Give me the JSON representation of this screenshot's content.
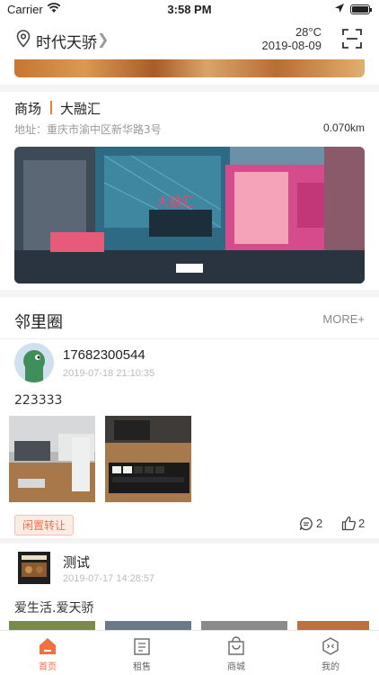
{
  "status_bar": {
    "carrier": "Carrier",
    "time": "3:58 PM"
  },
  "header": {
    "location": "时代天骄",
    "temperature": "28°C",
    "date": "2019-08-09"
  },
  "mall": {
    "type_label": "商场",
    "name": "大融汇",
    "address": "地址：重庆市渝中区新华路3号",
    "distance": "0.070km"
  },
  "neighbor": {
    "title": "邻里圈",
    "more": "MORE+",
    "posts": [
      {
        "user": "17682300544",
        "time": "2019-07-18 21:10:35",
        "text": "223333",
        "tag": "闲置转让",
        "comments": "2",
        "likes": "2"
      },
      {
        "user": "测试",
        "time": "2019-07-17 14:28:57",
        "text": "爱生活.爱天骄"
      }
    ]
  },
  "tabbar": {
    "accent": "#f07040",
    "items": [
      {
        "label": "首页",
        "icon": "home-icon"
      },
      {
        "label": "租售",
        "icon": "building-icon"
      },
      {
        "label": "商城",
        "icon": "shopping-bag-icon"
      },
      {
        "label": "我的",
        "icon": "profile-icon"
      }
    ]
  }
}
